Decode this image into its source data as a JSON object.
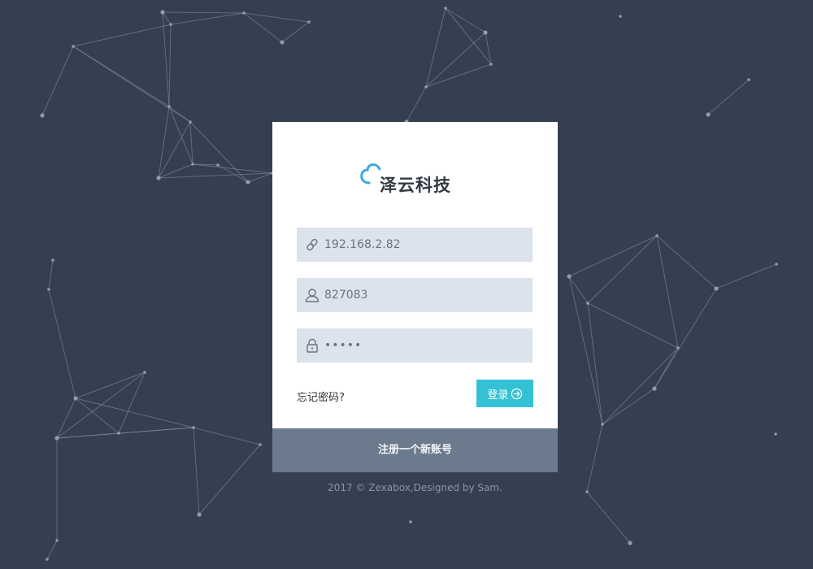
{
  "brand": {
    "name": "泽云科技",
    "logo_icon": "cloud-icon",
    "logo_color": "#3aa9dc"
  },
  "form": {
    "server_value": "192.168.2.82",
    "server_icon": "link-icon",
    "username_value": "827083",
    "username_icon": "user-icon",
    "password_value": "•••••",
    "password_icon": "lock-icon",
    "forgot_label": "忘记密码?",
    "login_label": "登录",
    "login_icon": "arrow-circle-right-icon"
  },
  "register": {
    "label": "注册一个新账号"
  },
  "footer": {
    "text": "2017 © Zexabox,Designed by Sam."
  },
  "colors": {
    "background": "#343f4f",
    "accent": "#35c1d4",
    "field_bg": "#dde3ec",
    "register_bg": "#6b7a8c"
  }
}
